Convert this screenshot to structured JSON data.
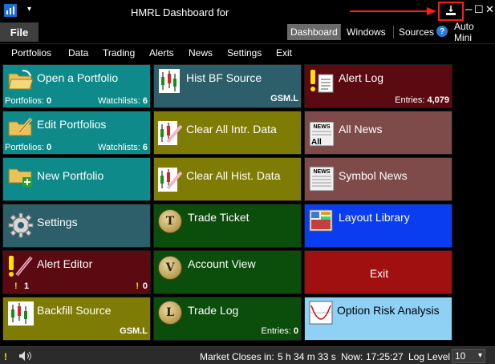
{
  "window": {
    "title": "HMRL Dashboard for",
    "sys_menu_glyph": "▾",
    "minimize_glyph": "–",
    "maximize_glyph": "☐",
    "close_glyph": "✕",
    "accent_red": "#ff1a1a"
  },
  "ribbon": {
    "file_label": "File",
    "tabs": [
      {
        "label": "Dashboard",
        "active": true
      },
      {
        "label": "Windows"
      },
      {
        "label": "Sources"
      },
      {
        "label": "Auto Mini"
      }
    ],
    "help_glyph": "?"
  },
  "menu": {
    "items": [
      "Portfolios",
      "Data",
      "Trading",
      "Alerts",
      "News",
      "Settings",
      "Exit"
    ]
  },
  "tiles": {
    "open_portfolio": {
      "label": "Open a Portfolio",
      "left_label": "Portfolios:",
      "left_value": "0",
      "right_label": "Watchlists:",
      "right_value": "6",
      "icon": "folder-open-icon"
    },
    "edit_portfolios": {
      "label": "Edit Portfolios",
      "left_label": "Portfolios:",
      "left_value": "0",
      "right_label": "Watchlists:",
      "right_value": "6",
      "icon": "folder-edit-icon"
    },
    "new_portfolio": {
      "label": "New Portfolio",
      "icon": "folder-add-icon"
    },
    "settings": {
      "label": "Settings",
      "icon": "gear-icon"
    },
    "alert_editor": {
      "label": "Alert Editor",
      "left_value": "1",
      "right_value": "0",
      "icon": "alert-edit-icon"
    },
    "backfill_source": {
      "label": "Backfill Source",
      "source": "GSM.L",
      "icon": "chart-candles-icon"
    },
    "hist_bf_source": {
      "label": "Hist BF Source",
      "source": "GSM.L",
      "icon": "chart-candles-icon"
    },
    "clear_intr": {
      "label": "Clear All Intr. Data",
      "icon": "chart-clear-icon"
    },
    "clear_hist": {
      "label": "Clear All Hist. Data",
      "icon": "chart-clear-icon"
    },
    "trade_ticket": {
      "label": "Trade Ticket",
      "coin": "T"
    },
    "account_view": {
      "label": "Account View",
      "coin": "V"
    },
    "trade_log": {
      "label": "Trade Log",
      "coin": "L",
      "entries_label": "Entries:",
      "entries_value": "0"
    },
    "alert_log": {
      "label": "Alert Log",
      "entries_label": "Entries:",
      "entries_value": "4,079",
      "icon": "alert-log-icon"
    },
    "all_news": {
      "label": "All News",
      "icon": "newspaper-icon",
      "badge": "All",
      "paper_text": "NEWS"
    },
    "symbol_news": {
      "label": "Symbol News",
      "icon": "newspaper-icon",
      "paper_text": "NEWS"
    },
    "layout_library": {
      "label": "Layout Library",
      "icon": "layout-icon"
    },
    "exit": {
      "label": "Exit"
    },
    "option_risk": {
      "label": "Option Risk Analysis",
      "icon": "payoff-chart-icon"
    }
  },
  "status": {
    "market_label": "Market Closes in:",
    "market_value": "5 h 34 m 33 s",
    "now_label": "Now:",
    "now_value": "17:25:27",
    "loglevel_label": "Log Level",
    "loglevel_value": "10",
    "dropdown_glyph": "▾"
  }
}
